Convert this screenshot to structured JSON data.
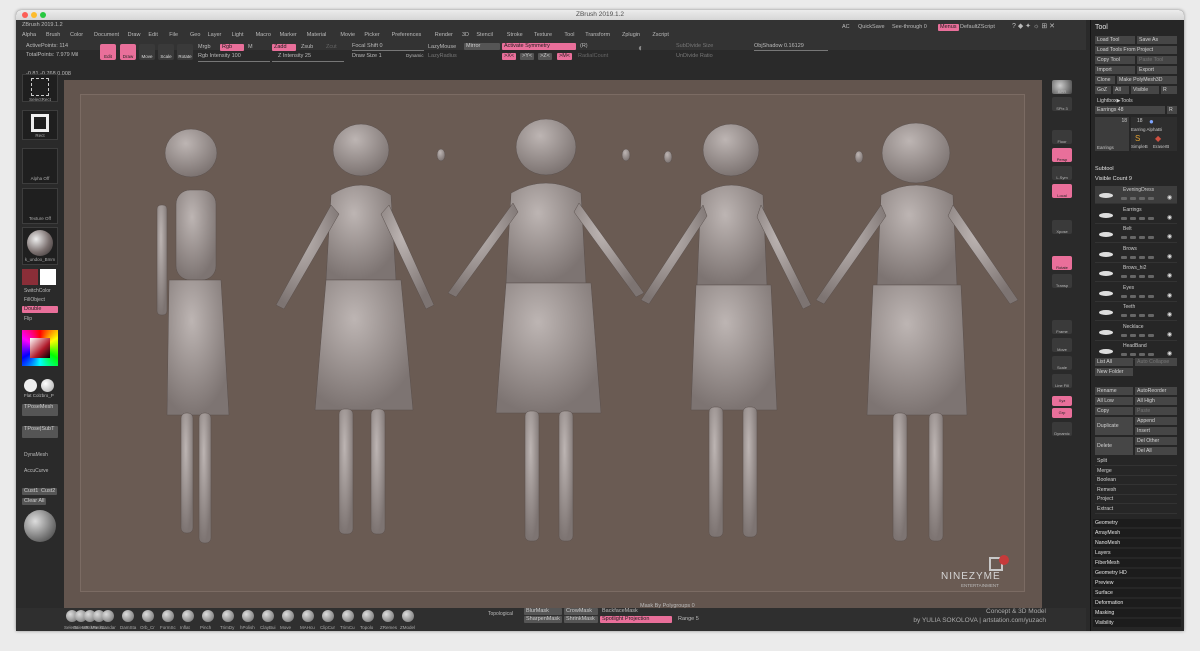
{
  "title": "ZBrush 2019.1.2",
  "app_name": "ZBrush 2019.1.2",
  "menus": [
    "Alpha",
    "Brush",
    "Color",
    "Document",
    "Draw",
    "Edit",
    "File",
    "Geo",
    "Layer",
    "Light",
    "Macro",
    "Marker",
    "Material",
    "Movie",
    "Picker",
    "Preferences",
    "Render",
    "3D",
    "Stencil",
    "Stroke",
    "Texture",
    "Tool",
    "Transform",
    "Zplugin",
    "Zscript"
  ],
  "top": {
    "ac": "AC",
    "quicksave": "QuickSave",
    "seethrough": "See-through 0",
    "menus": "Menus",
    "defaultzscript": "DefaultZScript"
  },
  "active_points": "ActivePoints: 114",
  "total_points": "TotalPoints: 7.979 Mil",
  "coords": "-0.81,-0.768,0.008",
  "tools": {
    "edit": "Edit",
    "draw": "Draw",
    "move": "Move",
    "scale": "Scale",
    "rotate": "Rotate"
  },
  "mrgb": "Mrgb",
  "rgb": "Rgb",
  "m": "M",
  "rgb_intensity": "Rgb Intensity 100",
  "zadd": "Zadd",
  "zsub": "Zsub",
  "zcut": "Zcut",
  "z_intensity": "Z Intensity 25",
  "focal": "Focal Shift 0",
  "draw_size": "Draw Size 1",
  "dynamic": "Dynamic",
  "lazymouse": "LazyMouse",
  "lazyradius": "LazyRadius",
  "mirror": "Mirror",
  "activate_symmetry": "Activate Symmetry",
  "r": "(R)",
  "axes": [
    ">X<",
    ">Y<",
    ">Z<",
    ">M<"
  ],
  "radialcount": "RadialCount",
  "subdivide": "SubDivide Size",
  "undivide": "UnDivide Ratio",
  "objshadow": "ObjShadow 0.16129",
  "left": {
    "selectrect": "SelectRect",
    "rect": "Rect",
    "alphaoff": "Alpha Off",
    "textureoff": "Texture Off",
    "material": "k_undoo_Bmm",
    "switchcolor": "SwitchColor",
    "fillobject": "FillObject",
    "double": "Double",
    "flip": "Flip",
    "flatcolor": "Flat Colzbro_P",
    "tposemesh": "TPoseMesh",
    "tposesubt": "TPose|SubT",
    "dynamesh": "DynaMesh",
    "accucurve": "AccuCurve",
    "cust1": "Cust1",
    "cust2": "Cust2",
    "clearall": "Clear All"
  },
  "right_shelf": [
    "BPR",
    "SPix 3",
    "Floor",
    "Persp",
    "L.Sym",
    "Local",
    "Xpose",
    "Frame",
    "Move",
    "Scale",
    "Rotate",
    "Line Fill",
    "PolyF",
    "Transp",
    "Ghost",
    "Solo",
    "Xyz",
    "Grp",
    "Dynamic"
  ],
  "tray": {
    "header": "Tool",
    "load_tool": "Load Tool",
    "save_as": "Save As",
    "load_tools_project": "Load Tools From Project",
    "copy_tool": "Copy Tool",
    "paste_tool": "Paste Tool",
    "import": "Import",
    "export": "Export",
    "clone": "Clone",
    "make_polymesh": "Make PolyMesh3D",
    "goz": "GoZ",
    "all": "All",
    "visible": "Visible",
    "r": "R",
    "lightbox": "Lightbox▶Tools",
    "earrings": "Earrings 48",
    "r2": "R",
    "n18a": "18",
    "n18b": "18",
    "earring_alpha": "Earring AlphaBi",
    "earrings_thumb": "Earrings",
    "simple_brush": "SimpleB",
    "eraser": "EraserB",
    "subtool": "Subtool",
    "visible_count": "Visible Count 9",
    "subtools": [
      "EveningDress",
      "Earrings",
      "Belt",
      "Brows",
      "Brows_hi2",
      "Eyes",
      "Teeth",
      "Necklace",
      "HeadBand"
    ],
    "list_all": "List All",
    "auto_collapse": "Auto Collapse",
    "new_folder": "New Folder",
    "rename": "Rename",
    "autoreorder": "AutoReorder",
    "all_low": "All Low",
    "all_high": "All High",
    "copy": "Copy",
    "paste": "Paste",
    "duplicate": "Duplicate",
    "append": "Append",
    "insert": "Insert",
    "delete": "Delete",
    "del_other": "Del Other",
    "del_all": "Del All",
    "sections": [
      "Split",
      "Merge",
      "Boolean",
      "Remesh",
      "Project",
      "Extract"
    ],
    "sections2": [
      "Geometry",
      "ArrayMesh",
      "NanoMesh",
      "Layers",
      "FiberMesh",
      "Geometry HD",
      "Preview",
      "Surface",
      "Deformation",
      "Masking",
      "Visibility"
    ]
  },
  "bottom": {
    "brushes": [
      "SelectL",
      "SelectR",
      "MaskPe",
      "MaskLa",
      "Standar",
      "DamSta",
      "Orb_Cr",
      "FormSc",
      "Inflat",
      "Pinch",
      "TrimDy",
      "hPolish",
      "ClayBui",
      "Move",
      "MAHcu",
      "ClipCur",
      "TrimCu",
      "Topolo",
      "ZRemes",
      "ZModel"
    ],
    "topological": "Topological",
    "blurmask": "BlurMask",
    "sharpenmask": "SharpenMask",
    "crowmask": "CrowMask",
    "shrinkmask": "ShrinkMask",
    "backfacemask": "BackfaceMask",
    "spotlight": "Spotlight Projection",
    "mask_polygroups": "Mask By Polygroups 0",
    "range": "Range 5"
  },
  "credit": {
    "logo": "NINEZYME",
    "logo_sub": "ENTERTAINMENT",
    "line1": "Concept & 3D Model",
    "line2": "by YULIA SOKOLOVA | artstation.com/yuzach"
  },
  "colors": {
    "accent": "#e96f9a",
    "canvas": "#63554e",
    "figure": "#a19896"
  }
}
